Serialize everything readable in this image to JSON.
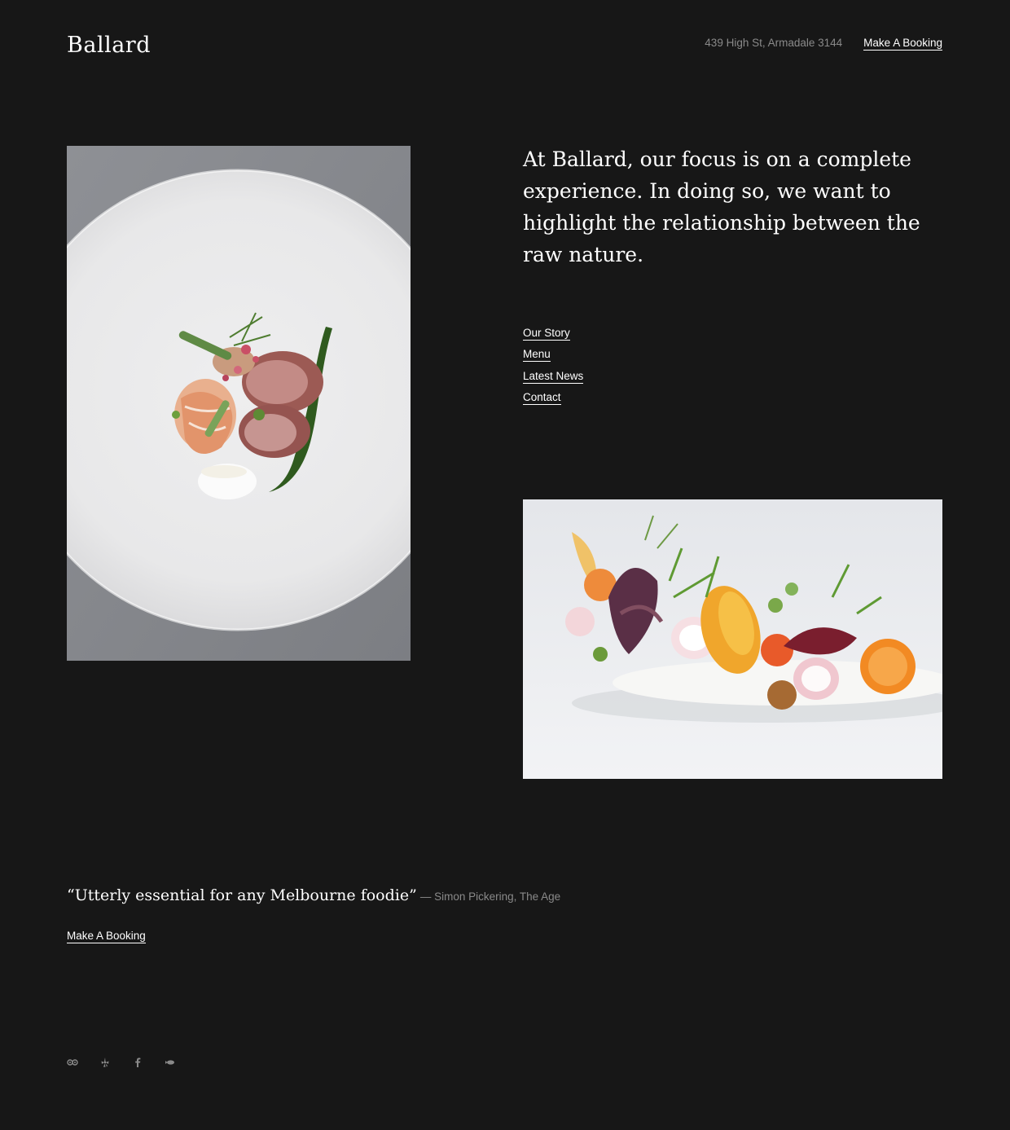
{
  "header": {
    "logo": "Ballard",
    "address": "439 High St, Armadale 3144",
    "booking_label": "Make A Booking"
  },
  "intro": {
    "text": "At Ballard, our focus is on a complete experience. In doing so, we want to highlight the relationship between the raw nature."
  },
  "nav": {
    "items": [
      {
        "label": "Our Story"
      },
      {
        "label": "Menu"
      },
      {
        "label": "Latest News"
      },
      {
        "label": "Contact"
      }
    ]
  },
  "testimonial": {
    "quote": "“Utterly essential for any Melbourne foodie”",
    "attribution": "— Simon Pickering, The Age"
  },
  "footer": {
    "booking_label": "Make A Booking",
    "social_icons": [
      "tripadvisor-icon",
      "yelp-icon",
      "facebook-icon",
      "zomato-icon"
    ]
  },
  "colors": {
    "background": "#171717",
    "text": "#ffffff",
    "muted": "#8a8a8a"
  }
}
